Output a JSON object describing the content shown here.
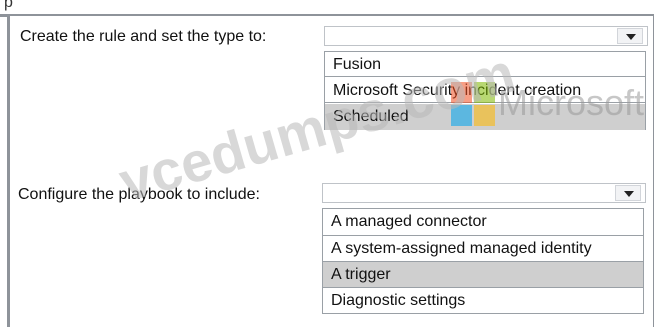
{
  "header_fragment": "p",
  "question1": {
    "label": "Create the rule and set the type to:",
    "options": [
      "Fusion",
      "Microsoft Security incident creation",
      "Scheduled"
    ],
    "selected_index": 2
  },
  "question2": {
    "label": "Configure the playbook to include:",
    "options": [
      "A managed connector",
      "A system-assigned managed identity",
      "A trigger",
      "Diagnostic settings"
    ],
    "selected_index": 2
  },
  "watermark": {
    "site_text": "vcedumps.com",
    "brand_text": "Microsoft",
    "logo_colors": [
      "#f25022",
      "#7fba00",
      "#00a4ef",
      "#ffb900"
    ]
  }
}
